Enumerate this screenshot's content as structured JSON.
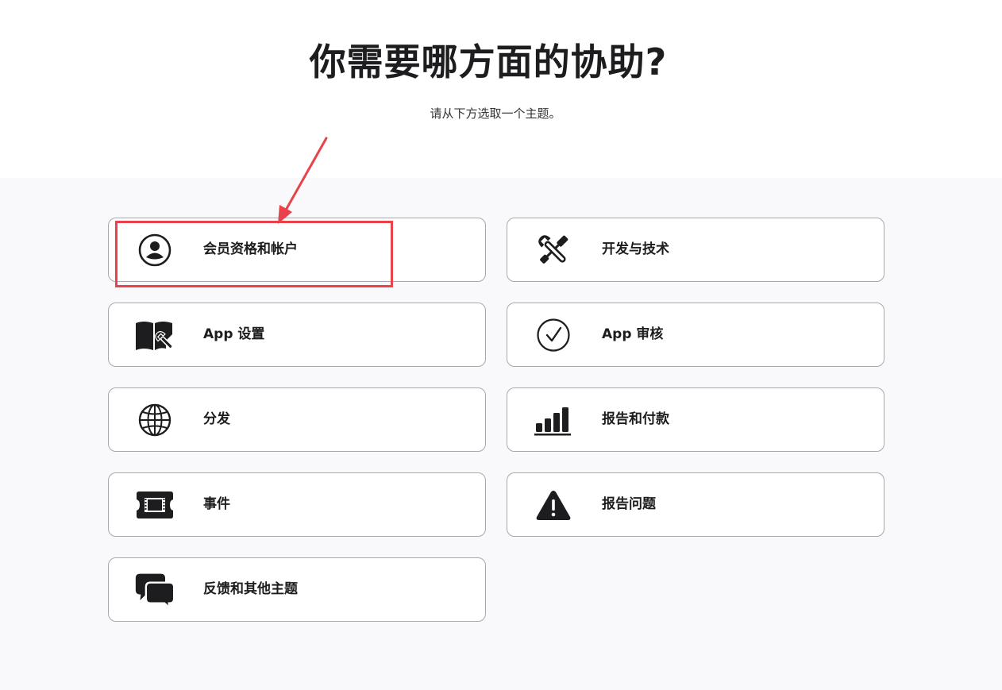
{
  "page": {
    "title": "你需要哪方面的协助?",
    "subtitle": "请从下方选取一个主题。"
  },
  "topics": [
    {
      "label": "会员资格和帐户",
      "icon": "person-circle-icon"
    },
    {
      "label": "开发与技术",
      "icon": "wrench-screwdriver-icon"
    },
    {
      "label": "App 设置",
      "icon": "book-wrench-icon"
    },
    {
      "label": "App 审核",
      "icon": "checkmark-circle-icon"
    },
    {
      "label": "分发",
      "icon": "globe-icon"
    },
    {
      "label": "报告和付款",
      "icon": "bar-chart-icon"
    },
    {
      "label": "事件",
      "icon": "film-ticket-icon"
    },
    {
      "label": "报告问题",
      "icon": "warning-triangle-icon"
    },
    {
      "label": "反馈和其他主题",
      "icon": "speech-bubbles-icon"
    }
  ],
  "annotation": {
    "color": "#e8434a",
    "highlighted_topic": "会员资格和帐户"
  }
}
